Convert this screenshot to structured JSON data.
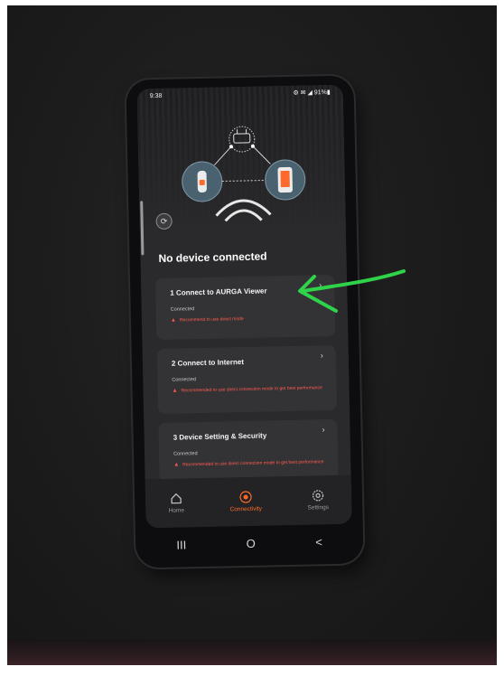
{
  "status_bar": {
    "time": "9:38",
    "indicators": "⚙ ✉ ◢ 91%▮"
  },
  "page": {
    "title": "No device connected"
  },
  "cards": [
    {
      "title": "1  Connect to AURGA Viewer",
      "status": "Connected",
      "warning": "Recommend to use direct mode"
    },
    {
      "title": "2  Connect to Internet",
      "status": "Connected",
      "warning": "Recommended to use direct connection mode to get best performance"
    },
    {
      "title": "3  Device Setting & Security",
      "status": "Connected",
      "warning": "Recommended to use direct connection mode to get best performance"
    }
  ],
  "chevron": "›",
  "tabs": [
    {
      "label": "Home",
      "icon": "home-icon"
    },
    {
      "label": "Connectivity",
      "icon": "connectivity-icon"
    },
    {
      "label": "Settings",
      "icon": "settings-icon"
    }
  ],
  "active_tab": "Connectivity",
  "system_nav": {
    "recents": "III",
    "home": "O",
    "back": "<"
  },
  "colors": {
    "accent": "#ff6a2b",
    "warning": "#ff5a4d",
    "annotation_arrow": "#2fd34a",
    "card_bg": "#333336"
  }
}
